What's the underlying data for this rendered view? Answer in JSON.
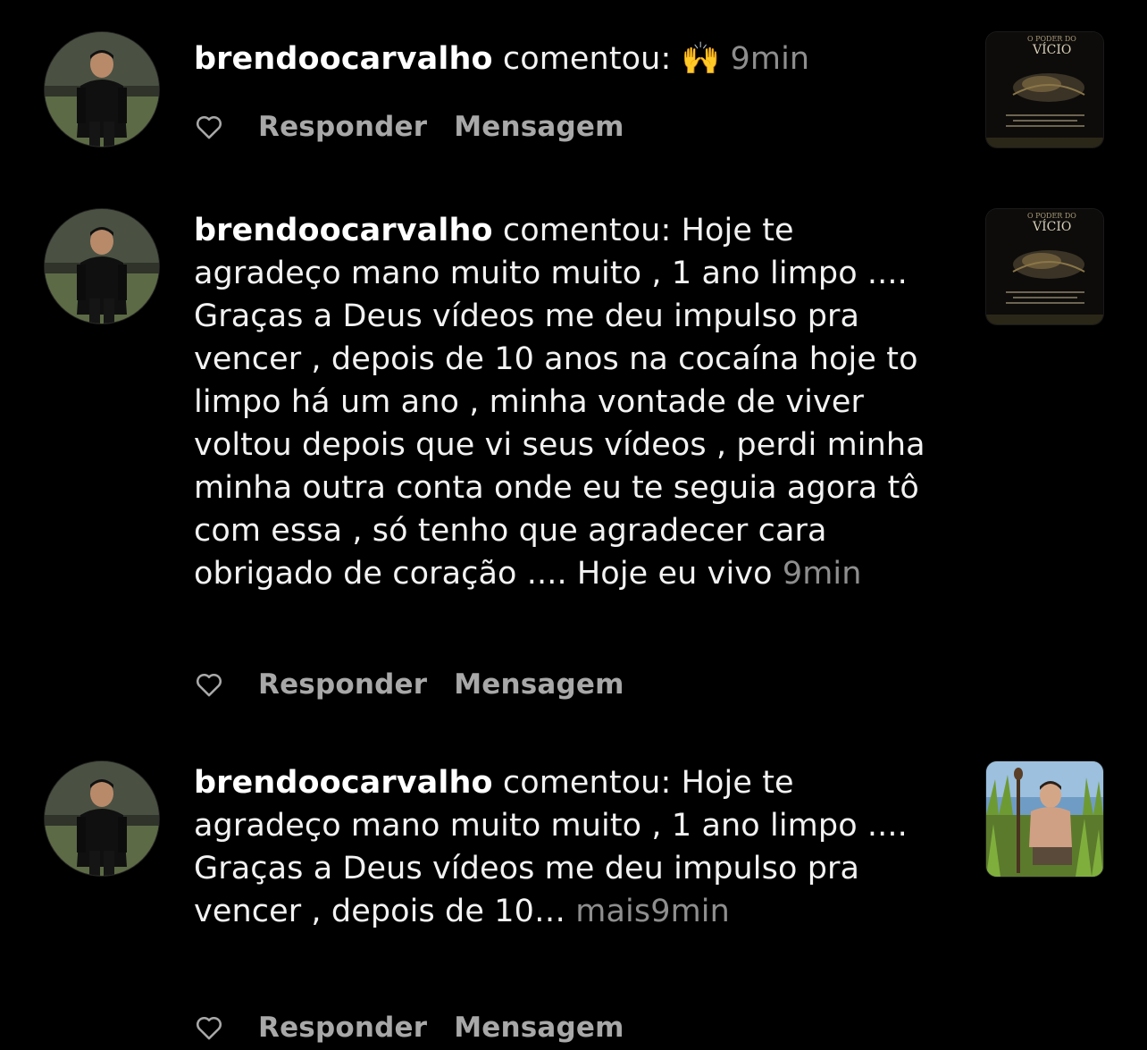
{
  "notifications": [
    {
      "username": "brendoocarvalho",
      "action": "comentou:",
      "comment": "🙌",
      "truncated": false,
      "more_label": "",
      "time": "9min",
      "like_icon": "heart-outline-icon",
      "reply_label": "Responder",
      "message_label": "Mensagem",
      "thumbnail": {
        "kind": "book-cover",
        "header": "O PODER DO",
        "title": "VÍCIO"
      }
    },
    {
      "username": "brendoocarvalho",
      "action": "comentou:",
      "comment": "Hoje te agradeço mano muito muito , 1 ano limpo .... Graças  a Deus vídeos me deu impulso pra vencer , depois de 10 anos na cocaína hoje to limpo há um ano , minha vontade de viver voltou depois que vi seus vídeos , perdi minha minha outra conta onde eu te seguia agora tô com essa , só tenho que agradecer cara obrigado de coração .... Hoje eu vivo",
      "truncated": false,
      "more_label": "",
      "time": "9min",
      "like_icon": "heart-outline-icon",
      "reply_label": "Responder",
      "message_label": "Mensagem",
      "thumbnail": {
        "kind": "book-cover",
        "header": "O PODER DO",
        "title": "VÍCIO"
      }
    },
    {
      "username": "brendoocarvalho",
      "action": "comentou:",
      "comment": "Hoje te agradeço mano muito muito , 1 ano limpo .... Graças  a Deus vídeos me deu impulso pra vencer , depois de 10…",
      "truncated": true,
      "more_label": "mais",
      "time": "9min",
      "like_icon": "heart-outline-icon",
      "reply_label": "Responder",
      "message_label": "Mensagem",
      "thumbnail": {
        "kind": "photo"
      }
    }
  ],
  "colors": {
    "background": "#000000",
    "text": "#f2f2f2",
    "secondary": "#8e8e8e",
    "action_text": "#a8a8a8"
  }
}
